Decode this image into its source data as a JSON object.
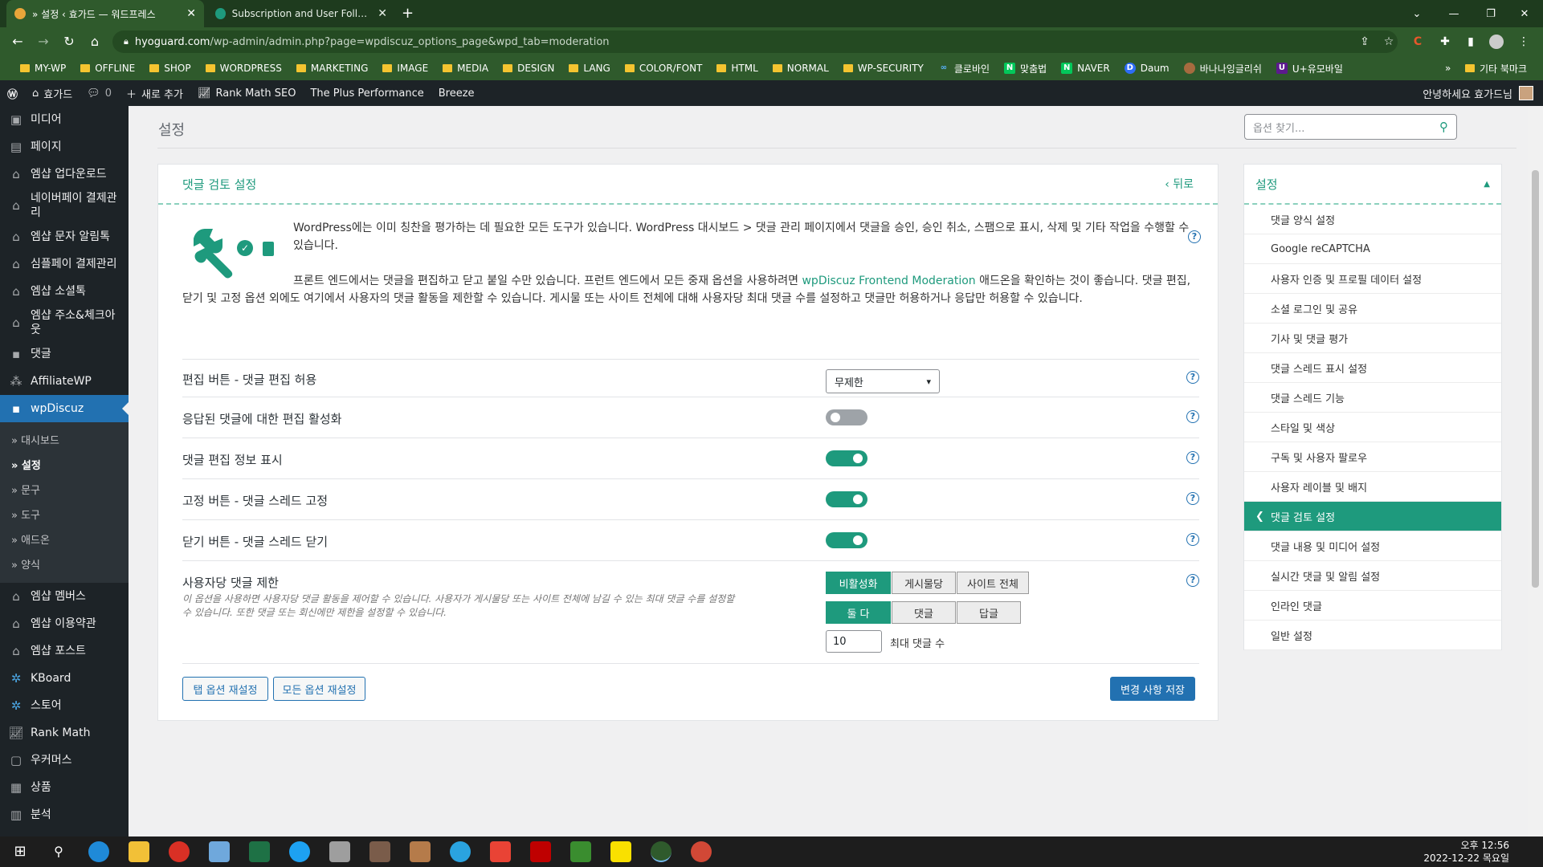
{
  "browser": {
    "tabs": [
      {
        "title": "» 설정 ‹ 효가드 — 워드프레스",
        "active": true
      },
      {
        "title": "Subscription and User Following",
        "active": false
      }
    ],
    "new_tab_label": "+",
    "url_domain": "hyoguard.com",
    "url_path": "/wp-admin/admin.php?page=wpdiscuz_options_page&wpd_tab=moderation",
    "bookmarks": [
      "MY-WP",
      "OFFLINE",
      "SHOP",
      "WORDPRESS",
      "MARKETING",
      "IMAGE",
      "MEDIA",
      "DESIGN",
      "LANG",
      "COLOR/FONT",
      "HTML",
      "NORMAL",
      "WP-SECURITY",
      "클로바인",
      "맞춤법",
      "NAVER",
      "Daum",
      "바나나잉글리쉬",
      "U+유모바일"
    ],
    "bookmarks_more": "»",
    "bookmarks_other": "기타 북마크"
  },
  "adminbar": {
    "site_name": "효가드",
    "comments_count": "0",
    "new_label": "새로 추가",
    "rank_math": "Rank Math SEO",
    "plus_performance": "The Plus Performance",
    "breeze": "Breeze",
    "greeting": "안녕하세요 효가드님"
  },
  "sidebar": {
    "items_top": [
      {
        "label": "미디어",
        "icon": "media-icon"
      },
      {
        "label": "페이지",
        "icon": "page-icon"
      },
      {
        "label": "엠샵 업다운로드",
        "icon": "mshop-icon"
      },
      {
        "label": "네이버페이 결제관리",
        "icon": "mshop-icon"
      },
      {
        "label": "엠샵 문자 알림톡",
        "icon": "mshop-icon"
      },
      {
        "label": "심플페이 결제관리",
        "icon": "mshop-icon"
      },
      {
        "label": "엠샵 소셜톡",
        "icon": "mshop-icon"
      },
      {
        "label": "엠샵 주소&체크아웃",
        "icon": "mshop-icon"
      },
      {
        "label": "댓글",
        "icon": "comment-icon"
      },
      {
        "label": "AffiliateWP",
        "icon": "affiliate-icon"
      }
    ],
    "current": {
      "label": "wpDiscuz",
      "icon": "comment-icon"
    },
    "submenu": [
      "» 대시보드",
      "» 설정",
      "» 문구",
      "» 도구",
      "» 애드온",
      "» 양식"
    ],
    "submenu_current_index": 1,
    "items_bottom": [
      {
        "label": "엠샵 멤버스",
        "icon": "mshop-icon"
      },
      {
        "label": "엠샵 이용약관",
        "icon": "mshop-icon"
      },
      {
        "label": "엠샵 포스트",
        "icon": "mshop-icon"
      },
      {
        "label": "KBoard",
        "icon": "kboard-icon"
      },
      {
        "label": "스토어",
        "icon": "kboard-icon"
      },
      {
        "label": "Rank Math",
        "icon": "rankmath-icon"
      },
      {
        "label": "우커머스",
        "icon": "woo-icon"
      },
      {
        "label": "상품",
        "icon": "product-icon"
      },
      {
        "label": "분석",
        "icon": "chart-icon"
      }
    ]
  },
  "page": {
    "title": "설정",
    "search_placeholder": "옵션 찾기...",
    "panel_title": "댓글 검토 설정",
    "back_label": "‹ 뒤로",
    "intro_p1": "WordPress에는 이미 칭찬을 평가하는 데 필요한 모든 도구가 있습니다. WordPress 대시보드 > 댓글 관리 페이지에서 댓글을 승인, 승인 취소, 스팸으로 표시, 삭제 및 기타 작업을 수행할 수 있습니다.",
    "intro_p2_a": "프론트 엔드에서는 댓글을 편집하고 닫고 붙일 수만 있습니다. 프런트 엔드에서 모든 중재 옵션을 사용하려면",
    "intro_p2_link": "wpDiscuz Frontend Moderation",
    "intro_p2_b": "애드온을 확인하는 것이 좋습니다. 댓글 편집, 닫기 및 고정 옵션 외에도 여기에서 사용자의 댓글 활동을 제한할 수 있습니다. 게시물 또는 사이트 전체에 대해 사용자당 최대 댓글 수를 설정하고 댓글만 허용하거나 응답만 허용할 수 있습니다.",
    "options": {
      "edit_button": {
        "label": "편집 버튼 - 댓글 편집 허용",
        "value": "무제한"
      },
      "edit_replied": {
        "label": "응답된 댓글에 대한 편집 활성화",
        "enabled": false
      },
      "edit_info": {
        "label": "댓글 편집 정보 표시",
        "enabled": true
      },
      "stick_button": {
        "label": "고정 버튼 - 댓글 스레드 고정",
        "enabled": true
      },
      "close_button": {
        "label": "닫기 버튼 - 댓글 스레드 닫기",
        "enabled": true
      },
      "limit": {
        "label": "사용자당 댓글 제한",
        "description": "이 옵션을 사용하면 사용자당 댓글 활동을 제어할 수 있습니다. 사용자가 게시물당 또는 사이트 전체에 남길 수 있는 최대 댓글 수를 설정할 수 있습니다. 또한 댓글 또는 회신에만 제한을 설정할 수 있습니다.",
        "scope_options": [
          "비활성화",
          "게시물당",
          "사이트 전체"
        ],
        "scope_selected": "비활성화",
        "type_options": [
          "둘 다",
          "댓글",
          "답글"
        ],
        "type_selected": "둘 다",
        "max_value": "10",
        "max_label": "최대 댓글 수"
      }
    },
    "reset_tab_label": "탭 옵션 재설정",
    "reset_all_label": "모든 옵션 재설정",
    "save_label": "변경 사항 저장",
    "help_glyph": "?"
  },
  "settings_nav": {
    "title": "설정",
    "items": [
      "댓글 양식 설정",
      "Google reCAPTCHA",
      "사용자 인증 및 프로필 데이터 설정",
      "소셜 로그인 및 공유",
      "기사 및 댓글 평가",
      "댓글 스레드 표시 설정",
      "댓글 스레드 기능",
      "스타일 및 색상",
      "구독 및 사용자 팔로우",
      "사용자 레이블 및 배지",
      "댓글 검토 설정",
      "댓글 내용 및 미디어 설정",
      "실시간 댓글 및 알림 설정",
      "인라인 댓글",
      "일반 설정"
    ],
    "active": "댓글 검토 설정"
  },
  "taskbar": {
    "time": "오후 12:56",
    "date": "2022-12-22 목요일"
  },
  "colors": {
    "accent": "#1e9a7d",
    "wp_blue": "#2271b1",
    "chrome_green": "#2f5a2c"
  }
}
